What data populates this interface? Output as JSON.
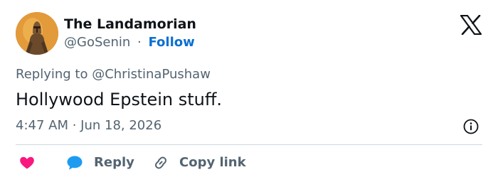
{
  "author": {
    "name": "The Landamorian",
    "handle": "@GoSenin",
    "separator": "·",
    "follow_label": "Follow"
  },
  "tweet": {
    "replying_to": "Replying to @ChristinaPushaw",
    "text": "Hollywood Epstein stuff.",
    "timestamp": "4:47 AM · Jun 18, 2026"
  },
  "actions": {
    "reply_label": "Reply",
    "copy_link_label": "Copy link"
  },
  "icons": {
    "brand": "x-logo-icon",
    "info": "info-icon",
    "like": "heart-icon",
    "reply": "speech-bubble-icon",
    "copy_link": "link-icon"
  },
  "colors": {
    "follow": "#0c6fd1",
    "heart": "#f91880",
    "reply_bubble": "#1d9bf0",
    "secondary_text": "#536471",
    "primary_text": "#0f1419",
    "divider": "#cfd9de"
  }
}
